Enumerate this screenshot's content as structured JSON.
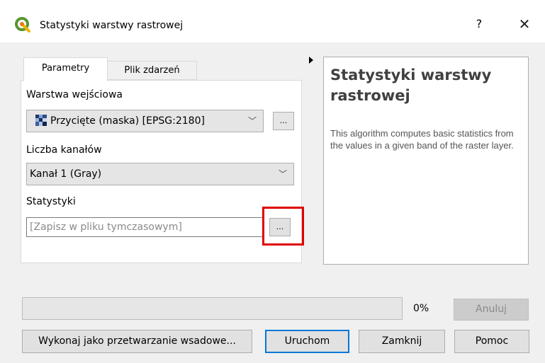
{
  "window": {
    "title": "Statystyki warstwy rastrowej",
    "help_glyph": "?",
    "close_glyph": "✕",
    "logo_icon": "qgis-logo-icon",
    "logo_color": "#589632"
  },
  "tabs": [
    {
      "label": "Parametry",
      "active": true
    },
    {
      "label": "Plik zdarzeń",
      "active": false
    }
  ],
  "params": {
    "input_layer_label": "Warstwa wejściowa",
    "input_layer_value": "Przycięte (maska) [EPSG:2180]",
    "input_layer_browse": "...",
    "band_label": "Liczba kanałów",
    "band_value": "Kanał 1 (Gray)",
    "stats_label": "Statystyki",
    "stats_placeholder": "[Zapisz w pliku tymczasowym]",
    "stats_browse": "..."
  },
  "help": {
    "title": "Statystyki warstwy rastrowej",
    "description": "This algorithm computes basic statistics from the values in a given band of the raster layer."
  },
  "progress": {
    "value": 0,
    "label": "0%",
    "fill_color": "#06b025"
  },
  "buttons": {
    "cancel": "Anuluj",
    "batch": "Wykonaj jako przetwarzanie wsadowe...",
    "run": "Uruchom",
    "close": "Zamknij",
    "help": "Pomoc"
  },
  "colors": {
    "highlight": "#e00000",
    "focus": "#0078d7"
  }
}
